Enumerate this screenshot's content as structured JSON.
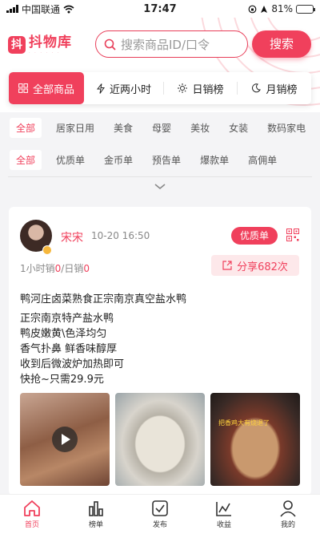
{
  "status_bar": {
    "carrier": "中国联通",
    "time": "17:47",
    "battery": "81%",
    "battery_level": 0.81
  },
  "header": {
    "logo_mark": "抖",
    "logo_name": "抖物库",
    "search_placeholder": "搜索商品ID/口令",
    "search_button": "搜索"
  },
  "ranks": [
    {
      "label": "全部商品",
      "icon": "grid-icon"
    },
    {
      "label": "近两小时",
      "icon": "lightning-icon"
    },
    {
      "label": "日销榜",
      "icon": "sun-icon"
    },
    {
      "label": "月销榜",
      "icon": "moon-icon"
    }
  ],
  "categories": [
    "全部",
    "居家日用",
    "美食",
    "母婴",
    "美妆",
    "女装",
    "数码家电"
  ],
  "filters": [
    "全部",
    "优质单",
    "金币单",
    "预告单",
    "爆款单",
    "高佣单"
  ],
  "post": {
    "user": "宋宋",
    "time": "10-20 16:50",
    "tag": "优质单",
    "sales_hour_label": "1小时销",
    "sales_hour_value": "0",
    "sales_day_label": "/日销",
    "sales_day_value": "0",
    "share": "分享682次",
    "title": "鸭河庄卤菜熟食正宗南京真空盐水鸭",
    "lines": [
      "正宗南京特产盐水鸭",
      "鸭皮嫩黄\\色泽均匀",
      "香气扑鼻 鲜香味醇厚",
      "收到后微波炉加热即可",
      "快抢~只需29.9元"
    ],
    "image3_caption": "把香鸡大有烧退了"
  },
  "tabbar": [
    {
      "label": "首页",
      "icon": "home-icon"
    },
    {
      "label": "榜单",
      "icon": "bar-chart-icon"
    },
    {
      "label": "发布",
      "icon": "publish-icon"
    },
    {
      "label": "收益",
      "icon": "earnings-icon"
    },
    {
      "label": "我的",
      "icon": "user-icon"
    }
  ],
  "colors": {
    "accent": "#f0405c",
    "accent_light": "#fde8ea"
  }
}
